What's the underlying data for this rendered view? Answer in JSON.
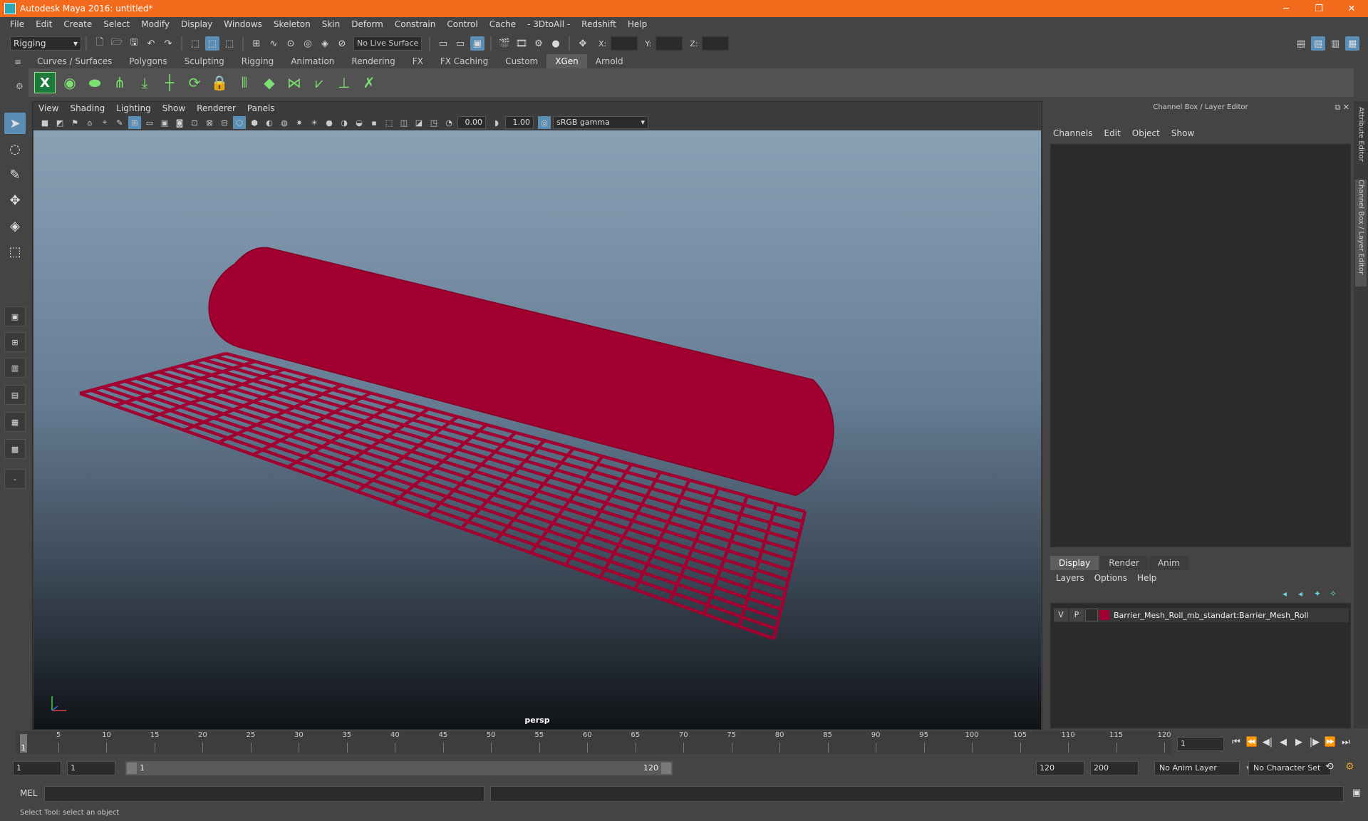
{
  "titlebar": {
    "title": "Autodesk Maya 2016: untitled*",
    "minimize": "─",
    "restore": "❐",
    "close": "✕"
  },
  "menubar": {
    "items": [
      "File",
      "Edit",
      "Create",
      "Select",
      "Modify",
      "Display",
      "Windows",
      "Skeleton",
      "Skin",
      "Deform",
      "Constrain",
      "Control",
      "Cache",
      "- 3DtoAll -",
      "Redshift",
      "Help"
    ]
  },
  "statusline": {
    "mode": "Rigging",
    "live_surface": "No Live Surface",
    "x_label": "X:",
    "y_label": "Y:",
    "z_label": "Z:"
  },
  "shelf": {
    "tabs": [
      "Curves / Surfaces",
      "Polygons",
      "Sculpting",
      "Rigging",
      "Animation",
      "Rendering",
      "FX",
      "FX Caching",
      "Custom",
      "XGen",
      "Arnold"
    ],
    "active_tab": "XGen"
  },
  "viewport": {
    "menu": [
      "View",
      "Shading",
      "Lighting",
      "Show",
      "Renderer",
      "Panels"
    ],
    "exposure": "0.00",
    "gamma": "1.00",
    "color_space": "sRGB gamma",
    "camera": "persp"
  },
  "right_panel": {
    "title": "Channel Box / Layer Editor",
    "menu": [
      "Channels",
      "Edit",
      "Object",
      "Show"
    ],
    "tabs": [
      "Display",
      "Render",
      "Anim"
    ],
    "layer_menu": [
      "Layers",
      "Options",
      "Help"
    ],
    "layer": {
      "visible": "V",
      "playback": "P",
      "name": "Barrier_Mesh_Roll_mb_standart:Barrier_Mesh_Roll",
      "color": "#a10030"
    }
  },
  "side_tabs": {
    "attribute_editor": "Attribute Editor",
    "channel_box": "Channel Box / Layer Editor"
  },
  "timeline": {
    "ticks": [
      "5",
      "10",
      "15",
      "20",
      "25",
      "30",
      "35",
      "40",
      "45",
      "50",
      "55",
      "60",
      "65",
      "70",
      "75",
      "80",
      "85",
      "90",
      "95",
      "100",
      "105",
      "110",
      "115",
      "120"
    ],
    "current": "1",
    "current_field": "1"
  },
  "range": {
    "start": "1",
    "playback_start": "1",
    "slider_start": "1",
    "slider_end": "120",
    "playback_end": "120",
    "end": "200",
    "anim_layer": "No Anim Layer",
    "character_set": "No Character Set"
  },
  "cmdline": {
    "label": "MEL"
  },
  "helpline": {
    "text": "Select Tool: select an object"
  },
  "colors": {
    "accent": "#f26a1c",
    "mesh": "#a10030",
    "active": "#5b8eb5"
  }
}
